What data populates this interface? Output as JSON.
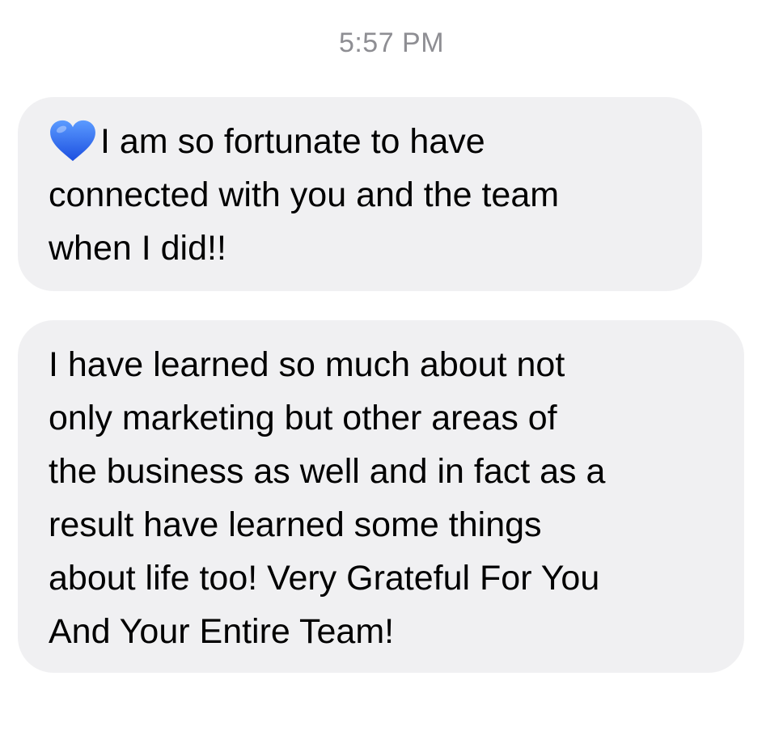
{
  "conversation": {
    "timestamp": "5:57 PM",
    "messages": [
      {
        "icon": "blue-heart-icon",
        "lines": [
          "I am so fortunate to have",
          "connected with you and the team",
          "when I did!!"
        ]
      },
      {
        "lines": [
          "I have learned so much about not",
          "only marketing but other areas of",
          "the business as well and in fact as a",
          "result have learned some things",
          "about life too! Very Grateful For You",
          "And Your Entire Team!"
        ]
      }
    ]
  },
  "colors": {
    "bubble_background": "#f0f0f2",
    "timestamp_text": "#8e8e93",
    "heart": "#2f6ef5"
  }
}
